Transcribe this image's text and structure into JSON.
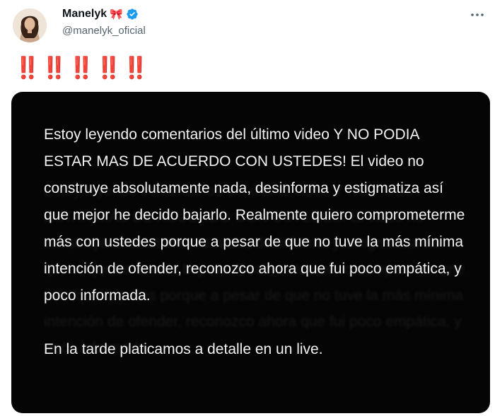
{
  "author": {
    "display_name": "Manelyk",
    "handle": "@manelyk_oficial",
    "name_emoji_icon": "bow-icon",
    "verified_icon": "verified-badge-icon",
    "verified_color": "#1d9bf0"
  },
  "tweet": {
    "text": "‼️‼️‼️‼️‼️",
    "text_color": "#c8102e"
  },
  "media": {
    "background": "#050505",
    "paragraph_1": "Estoy leyendo comentarios del último video Y NO PODIA ESTAR MAS DE ACUERDO CON USTEDES! El video no construye absolutamente nada, desinforma y estigmatiza así que mejor he decido bajarlo. Realmente quiero comprometerme más con ustedes porque a pesar de que no tuve la más mínima intención de ofender, reconozco ahora que fui poco empática, y poco informada.",
    "paragraph_2": "En la tarde platicamos a detalle en un live."
  },
  "menu": {
    "icon": "more-options-icon"
  }
}
